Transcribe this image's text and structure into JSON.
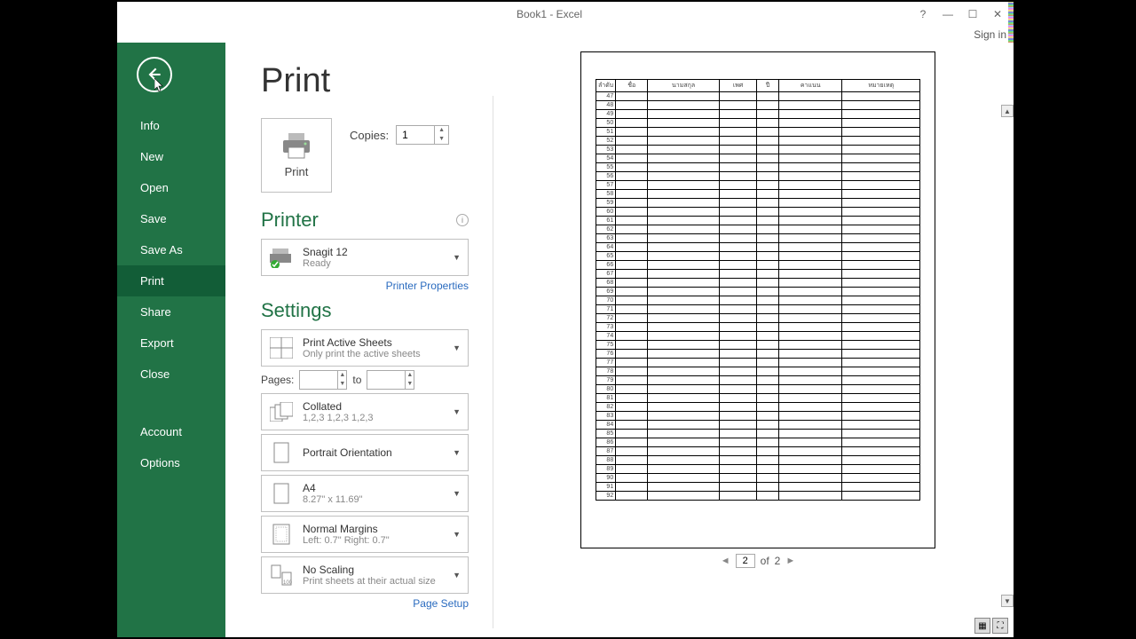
{
  "titlebar": {
    "title": "Book1 - Excel",
    "signin": "Sign in"
  },
  "sidebar": {
    "items": [
      {
        "label": "Info"
      },
      {
        "label": "New"
      },
      {
        "label": "Open"
      },
      {
        "label": "Save"
      },
      {
        "label": "Save As"
      },
      {
        "label": "Print"
      },
      {
        "label": "Share"
      },
      {
        "label": "Export"
      },
      {
        "label": "Close"
      },
      {
        "label": "Account"
      },
      {
        "label": "Options"
      }
    ]
  },
  "page": {
    "title": "Print"
  },
  "print": {
    "button_label": "Print",
    "copies_label": "Copies:",
    "copies_value": "1"
  },
  "printer": {
    "section": "Printer",
    "name": "Snagit 12",
    "status": "Ready",
    "properties_link": "Printer Properties"
  },
  "settings": {
    "section": "Settings",
    "activesheets": {
      "title": "Print Active Sheets",
      "sub": "Only print the active sheets"
    },
    "pages": {
      "label": "Pages:",
      "to": "to"
    },
    "collate": {
      "title": "Collated",
      "sub": "1,2,3    1,2,3    1,2,3"
    },
    "orientation": {
      "title": "Portrait Orientation"
    },
    "paper": {
      "title": "A4",
      "sub": "8.27\" x 11.69\""
    },
    "margins": {
      "title": "Normal Margins",
      "sub": "Left:  0.7\"    Right:  0.7\""
    },
    "scaling": {
      "title": "No Scaling",
      "sub": "Print sheets at their actual size"
    },
    "page_setup_link": "Page Setup"
  },
  "preview": {
    "headers": [
      "ลำดับ",
      "ชื่อ",
      "นามสกุล",
      "เพศ",
      "ปี",
      "คาแนน",
      "หมายเหตุ"
    ],
    "row_start": 47,
    "row_end": 92,
    "pager": {
      "current": "2",
      "total_prefix": "of",
      "total": "2"
    }
  }
}
